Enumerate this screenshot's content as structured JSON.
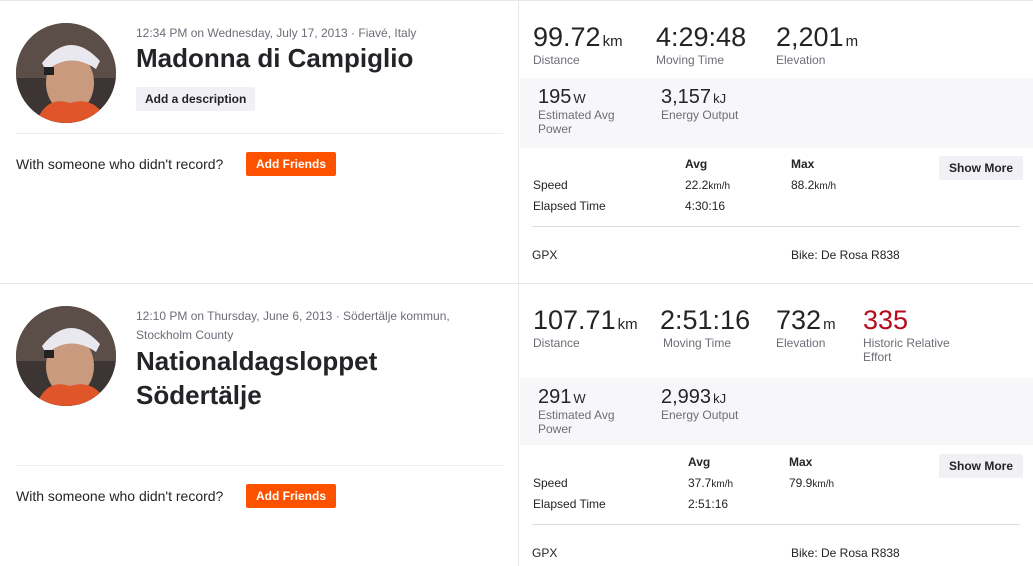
{
  "activities": [
    {
      "meta": "12:34 PM on Wednesday, July 17, 2013 · Fiavé, Italy",
      "meta_line2": "",
      "title_line1": "Madonna di Campiglio",
      "title_line2": "",
      "description_button": "Add a description",
      "with_someone": "With someone who didn't record?",
      "add_friends": "Add Friends",
      "stats": [
        {
          "value": "99.72",
          "unit": "km",
          "label": "Distance"
        },
        {
          "value": "4:29:48",
          "unit": "",
          "label": "Moving Time"
        },
        {
          "value": "2,201",
          "unit": "m",
          "label": "Elevation"
        }
      ],
      "secondary": [
        {
          "value": "195",
          "unit": "W",
          "label": "Estimated Avg",
          "label2": "Power"
        },
        {
          "value": "3,157",
          "unit": "kJ",
          "label": "Energy Output",
          "label2": ""
        }
      ],
      "table": {
        "avg_header": "Avg",
        "max_header": "Max",
        "speed_label": "Speed",
        "speed_avg": "22.2",
        "speed_avg_unit": "km/h",
        "speed_max": "88.2",
        "speed_max_unit": "km/h",
        "elapsed_label": "Elapsed Time",
        "elapsed_avg": "4:30:16"
      },
      "show_more": "Show More",
      "gpx": "GPX",
      "bike": "Bike: De Rosa R838"
    },
    {
      "meta": "12:10 PM on Thursday, June 6, 2013 · Södertälje kommun,",
      "meta_line2": "Stockholm County",
      "title_line1": "Nationaldagsloppet",
      "title_line2": "Södertälje",
      "description_button": "",
      "with_someone": "With someone who didn't record?",
      "add_friends": "Add Friends",
      "stats": [
        {
          "value": "107.71",
          "unit": "km",
          "label": "Distance"
        },
        {
          "value": "2:51:16",
          "unit": "",
          "label": "Moving Time"
        },
        {
          "value": "732",
          "unit": "m",
          "label": "Elevation"
        },
        {
          "value": "335",
          "unit": "",
          "label": "Historic Relative",
          "label2": "Effort"
        }
      ],
      "secondary": [
        {
          "value": "291",
          "unit": "W",
          "label": "Estimated Avg",
          "label2": "Power"
        },
        {
          "value": "2,993",
          "unit": "kJ",
          "label": "Energy Output",
          "label2": ""
        }
      ],
      "table": {
        "avg_header": "Avg",
        "max_header": "Max",
        "speed_label": "Speed",
        "speed_avg": "37.7",
        "speed_avg_unit": "km/h",
        "speed_max": "79.9",
        "speed_max_unit": "km/h",
        "elapsed_label": "Elapsed Time",
        "elapsed_avg": "2:51:16"
      },
      "show_more": "Show More",
      "gpx": "GPX",
      "bike": "Bike: De Rosa R838"
    }
  ],
  "colors": {
    "accent": "#fc5200",
    "relative_effort": "#b80a1c",
    "band": "#f7f7fa"
  }
}
